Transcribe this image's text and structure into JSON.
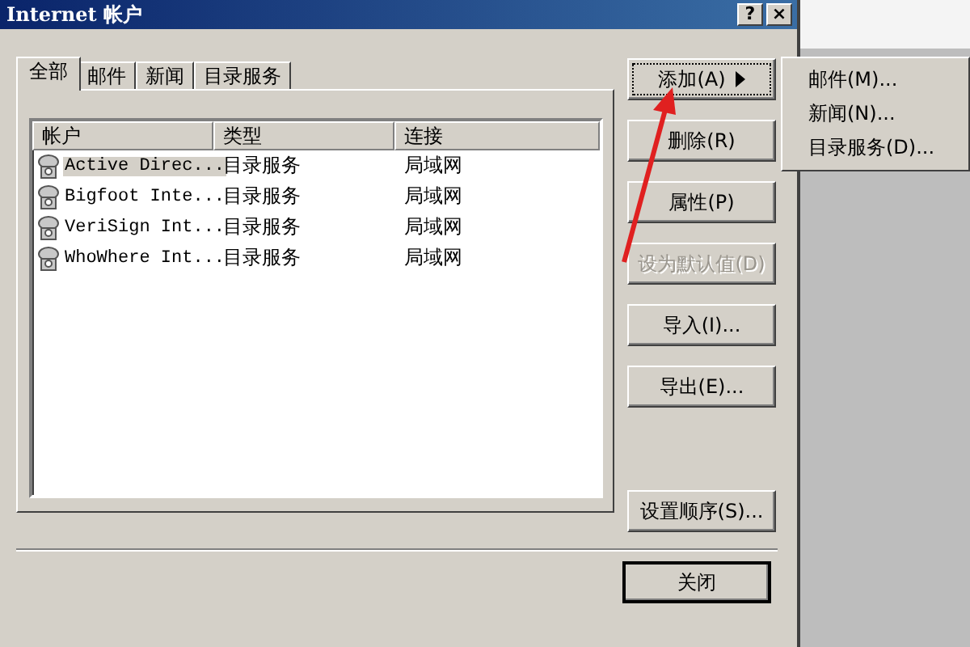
{
  "window": {
    "title": "Internet 帐户",
    "help_button": "?",
    "close_button": "×"
  },
  "tabs": [
    {
      "label": "全部",
      "selected": true
    },
    {
      "label": "邮件",
      "selected": false
    },
    {
      "label": "新闻",
      "selected": false
    },
    {
      "label": "目录服务",
      "selected": false
    }
  ],
  "table": {
    "columns": [
      "帐户",
      "类型",
      "连接"
    ],
    "rows": [
      {
        "cells": [
          "Active Direc...",
          "目录服务",
          "局域网"
        ],
        "selected": true
      },
      {
        "cells": [
          "Bigfoot Inte...",
          "目录服务",
          "局域网"
        ],
        "selected": false
      },
      {
        "cells": [
          "VeriSign Int...",
          "目录服务",
          "局域网"
        ],
        "selected": false
      },
      {
        "cells": [
          "WhoWhere Int...",
          "目录服务",
          "局域网"
        ],
        "selected": false
      }
    ]
  },
  "buttons": [
    {
      "label": "添加(A)",
      "disabled": false,
      "submenu": true
    },
    {
      "label": "删除(R)",
      "disabled": false,
      "submenu": false
    },
    {
      "label": "属性(P)",
      "disabled": false,
      "submenu": false
    },
    {
      "label": "设为默认值(D)",
      "disabled": true,
      "submenu": false
    },
    {
      "label": "导入(I)...",
      "disabled": false,
      "submenu": false
    },
    {
      "label": "导出(E)...",
      "disabled": false,
      "submenu": false
    },
    {
      "label": "设置顺序(S)...",
      "disabled": false,
      "submenu": false
    }
  ],
  "close_button": "关闭",
  "menu": {
    "items": [
      "邮件(M)...",
      "新闻(N)...",
      "目录服务(D)..."
    ]
  }
}
